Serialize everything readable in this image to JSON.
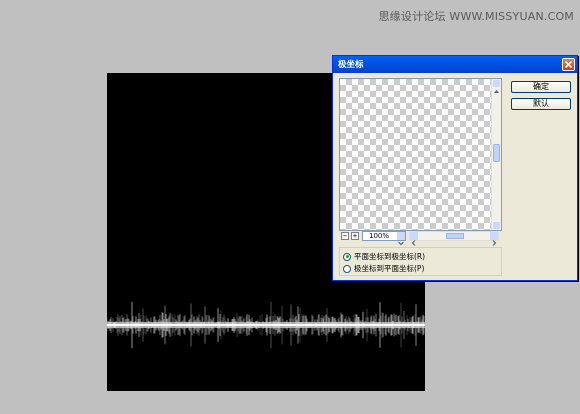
{
  "watermark": "思缘设计论坛 WWW.MISSYUAN.COM",
  "dialog": {
    "title": "极坐标",
    "ok_label": "确定",
    "cancel_label": "默认",
    "zoom_out_glyph": "−",
    "zoom_in_glyph": "+",
    "zoom_value": "100%",
    "options": [
      {
        "label": "平面坐标到极坐标(R)",
        "selected": true
      },
      {
        "label": "极坐标到平面坐标(P)",
        "selected": false
      }
    ]
  },
  "colors": {
    "desktop": "#c0c0c0",
    "canvas": "#000000",
    "title_bar": "#0054e3",
    "dialog_face": "#ece9d8",
    "radio_dot": "#21a121"
  },
  "icons": [
    "close-icon",
    "zoom-out-icon",
    "zoom-in-icon",
    "chevron-down-icon",
    "arrow-up-icon",
    "arrow-down-icon",
    "arrow-left-icon",
    "arrow-right-icon"
  ]
}
